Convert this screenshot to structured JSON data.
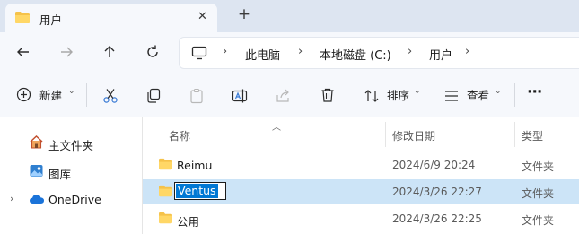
{
  "tab": {
    "title": "用户",
    "close_glyph": "✕",
    "new_glyph": "+"
  },
  "nav": {
    "breadcrumbs": [
      "此电脑",
      "本地磁盘 (C:)",
      "用户"
    ],
    "separator": "›"
  },
  "toolbar": {
    "new_label": "新建",
    "sort_label": "排序",
    "view_label": "查看",
    "more_glyph": "···",
    "caret_glyph": "⌄"
  },
  "sidebar": {
    "items": [
      {
        "label": "主文件夹",
        "icon": "home-icon"
      },
      {
        "label": "图库",
        "icon": "gallery-icon"
      },
      {
        "label": "OneDrive",
        "icon": "cloud-icon",
        "expander": "›"
      }
    ]
  },
  "columns": {
    "name": "名称",
    "date": "修改日期",
    "type": "类型"
  },
  "files": [
    {
      "name": "Reimu",
      "date": "2024/6/9 20:24",
      "type": "文件夹"
    },
    {
      "name": "Ventus",
      "date": "2024/3/26 22:27",
      "type": "文件夹",
      "selected": true,
      "renaming": true
    },
    {
      "name": "公用",
      "date": "2024/3/26 22:25",
      "type": "文件夹"
    }
  ],
  "colors": {
    "accent": "#0078d4",
    "selection": "#cce4f7",
    "folder": "#f5c24a"
  }
}
